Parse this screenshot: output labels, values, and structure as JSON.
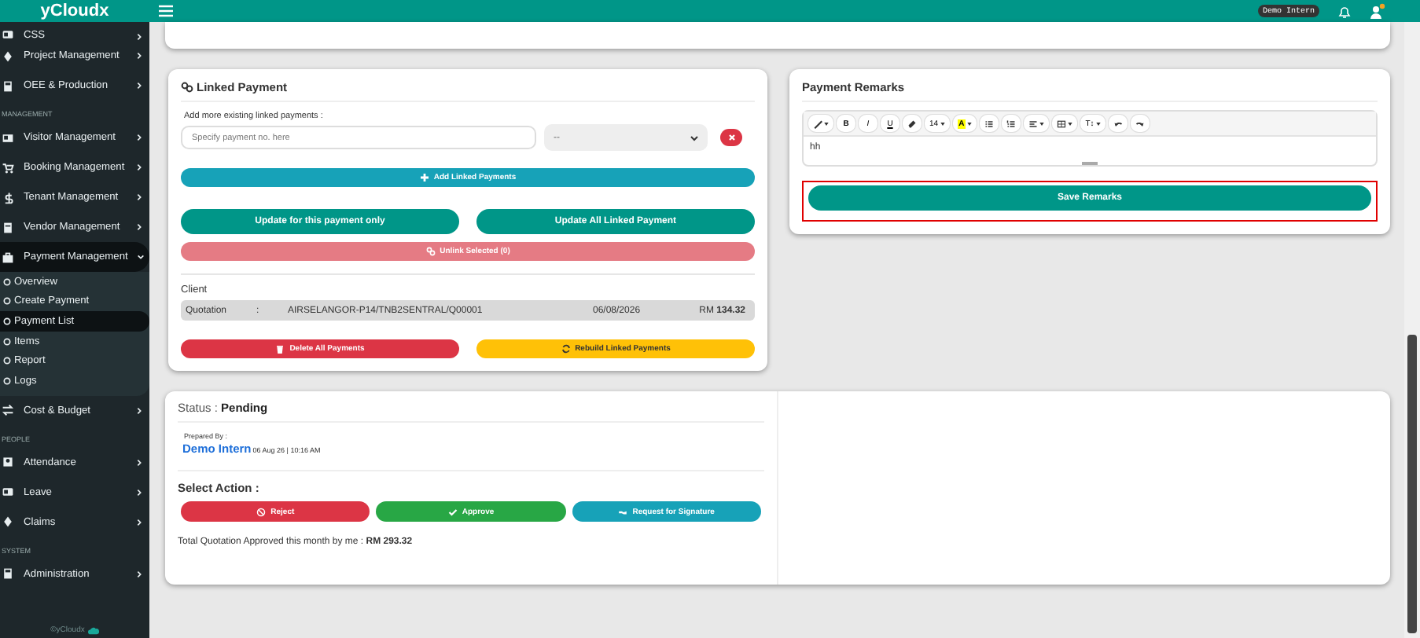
{
  "header": {
    "brand": "yCloudx",
    "user_badge": "Demo Intern"
  },
  "sidebar": {
    "sections": [
      {
        "items": [
          {
            "label": "CSS",
            "expanded": false
          },
          {
            "label": "Project Management",
            "expanded": false
          },
          {
            "label": "OEE & Production",
            "expanded": false
          }
        ]
      },
      {
        "label": "MANAGEMENT",
        "items": [
          {
            "label": "Visitor Management",
            "expanded": false
          },
          {
            "label": "Booking Management",
            "expanded": false
          },
          {
            "label": "Tenant Management",
            "expanded": false
          },
          {
            "label": "Vendor Management",
            "expanded": false
          },
          {
            "label": "Payment Management",
            "expanded": true,
            "children": [
              {
                "label": "Overview",
                "selected": false
              },
              {
                "label": "Create Payment",
                "selected": false
              },
              {
                "label": "Payment List",
                "selected": true
              },
              {
                "label": "Items",
                "selected": false
              },
              {
                "label": "Report",
                "selected": false
              },
              {
                "label": "Logs",
                "selected": false
              }
            ]
          },
          {
            "label": "Cost & Budget",
            "expanded": false
          }
        ]
      },
      {
        "label": "PEOPLE",
        "items": [
          {
            "label": "Attendance",
            "expanded": false
          },
          {
            "label": "Leave",
            "expanded": false
          },
          {
            "label": "Claims",
            "expanded": false
          }
        ]
      },
      {
        "label": "SYSTEM",
        "items": [
          {
            "label": "Administration",
            "expanded": false
          }
        ]
      }
    ],
    "footer": "©yCloudx"
  },
  "linked_payment": {
    "title": "Linked Payment",
    "add_label": "Add more existing linked payments :",
    "payment_field": {
      "placeholder": "Specify payment no. here"
    },
    "select": {
      "value": "--"
    },
    "add_button": "Add Linked Payments",
    "update_buttons": [
      "Update for this payment only",
      "Update All Linked Payment"
    ],
    "unlink_button": {
      "label": "Unlink Selected (0)",
      "disabled": true
    },
    "client_label": "Client",
    "rows": [
      {
        "type": "Quotation",
        "separator": ":",
        "reference": "AIRSELANGOR-P14/TNB2SENTRAL/Q00001",
        "date": "06/08/2026",
        "amount": "RM **134.32**"
      }
    ],
    "delete_button": "Delete All Payments",
    "rebuild_button": "Rebuild Linked Payments"
  },
  "payment_remarks": {
    "title": "Payment Remarks",
    "toolbar": [
      {
        "kind": "brush",
        "caret": true
      },
      {
        "kind": "text",
        "label": "B"
      },
      {
        "kind": "text",
        "label": "I"
      },
      {
        "kind": "text",
        "label": "U"
      },
      {
        "kind": "eraser",
        "caret": false
      },
      {
        "kind": "text",
        "label": "14",
        "caret": true
      },
      {
        "kind": "highlight",
        "label": "A",
        "caret": true
      },
      {
        "kind": "bullets",
        "caret": false
      },
      {
        "kind": "numbers",
        "caret": false
      },
      {
        "kind": "align",
        "caret": true
      },
      {
        "kind": "table",
        "caret": true
      },
      {
        "kind": "text",
        "label": "T↕",
        "caret": true
      },
      {
        "kind": "undo",
        "caret": false
      },
      {
        "kind": "redo",
        "caret": false
      }
    ],
    "content": "hh",
    "save_button": {
      "label": "Save Remarks",
      "highlighted": true
    }
  },
  "approval": {
    "status": "Status : **Pending**",
    "prepared_label": "Prepared By :",
    "prepared_name": "Demo Intern",
    "prepared_time": "06 Aug 26 | 10:16 AM",
    "action_label": "Select Action :",
    "actions": [
      {
        "kind": "reject",
        "label": "Reject"
      },
      {
        "kind": "approve",
        "label": "Approve"
      },
      {
        "kind": "signature",
        "label": "Request for Signature"
      }
    ],
    "total": "Total Quotation Approved this month by me : **RM 293.32**"
  }
}
